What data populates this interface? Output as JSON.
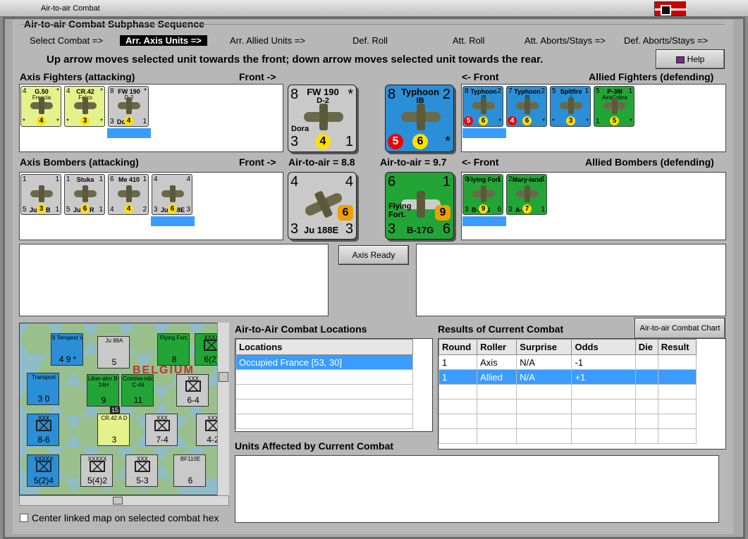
{
  "window": {
    "title": "Air-to-air Combat"
  },
  "sequence": {
    "title": "Air-to-air Combat Subphase Sequence",
    "steps": [
      "Select Combat =>",
      "Arr. Axis Units =>",
      "Arr. Allied Units =>",
      "Def. Roll",
      "Att. Roll",
      "Att. Aborts/Stays =>",
      "Def. Aborts/Stays =>"
    ],
    "active_index": 1
  },
  "instruction": "Up arrow moves selected unit towards the front; down arrow moves selected unit towards the rear.",
  "help_label": "Help",
  "axis_fighters": {
    "label": "Axis Fighters (attacking)",
    "front": "Front ->",
    "units": [
      {
        "tl": "4",
        "name": "G.50",
        "tr": "*",
        "sub": "Freccia",
        "bl": "*",
        "mid": "4",
        "br": "*",
        "color": "#e4f28c"
      },
      {
        "tl": "4",
        "name": "CR.42",
        "tr": "*",
        "sub": "Falco",
        "bl": "*",
        "mid": "3",
        "br": "*",
        "color": "#e4f28c"
      },
      {
        "tl": "8",
        "name": "FW 190",
        "tr": "*",
        "sub": "D-2",
        "sub2": "Dora",
        "bl": "3",
        "mid": "4",
        "br": "1",
        "color": "#c9c9c9"
      }
    ]
  },
  "axis_selected_fighter": {
    "tl": "8",
    "name": "FW 190",
    "sub": "D-2",
    "tr": "*",
    "sub2": "Dora",
    "bl": "3",
    "mid": "4",
    "br": "1"
  },
  "allied_selected_fighter": {
    "tl": "8",
    "name": "Typhoon",
    "sub": "IB",
    "tr": "2",
    "bl": "5",
    "mid": "6",
    "br": "*"
  },
  "allied_fighters": {
    "label": "Allied Fighters (defending)",
    "front": "<- Front",
    "units": [
      {
        "tl": "8",
        "name": "Typhoon",
        "sub": "IB",
        "tr": "2",
        "bl": "5",
        "mid": "6",
        "br": "*",
        "color": "#2a8fd6",
        "redbl": true
      },
      {
        "tl": "7",
        "name": "Typhoon",
        "sub": "IB",
        "tr": "2",
        "bl": "4",
        "mid": "6",
        "br": "*",
        "color": "#2a8fd6",
        "redbl": true
      },
      {
        "tl": "5",
        "name": "Spitfire",
        "sub": "I",
        "tr": "1",
        "bl": "*",
        "mid": "3",
        "br": "*",
        "color": "#2a8fd6"
      },
      {
        "tl": "5",
        "name": "P-39I",
        "sub": "AiraCobra",
        "tr": "1",
        "bl": "1",
        "mid": "5",
        "br": "*",
        "color": "#22a536"
      }
    ]
  },
  "axis_bombers": {
    "label": "Axis Bombers (attacking)",
    "front": "Front ->",
    "a2a": "Air-to-air = 8.8",
    "units": [
      {
        "tl": "1",
        "name": "",
        "tr": "1",
        "bl": "5",
        "mid": "3",
        "br": "1",
        "sub2": "Ju 87B",
        "color": "#c9c9c9"
      },
      {
        "tl": "1",
        "name": "Stuka",
        "tr": "1",
        "bl": "5",
        "mid": "6",
        "br": "1",
        "sub2": "Ju 87R",
        "color": "#c9c9c9"
      },
      {
        "tl": "6",
        "name": "Me 410",
        "tr": "1",
        "bl": "4",
        "mid": "4",
        "br": "2",
        "color": "#c9c9c9"
      },
      {
        "tl": "4",
        "name": "",
        "tr": "4",
        "bl": "3",
        "mid": "6",
        "br": "3",
        "sub2": "Ju 188E",
        "color": "#c9c9c9"
      }
    ]
  },
  "axis_selected_bomber": {
    "tl": "4",
    "tr": "4",
    "bl": "3",
    "name": "Ju 188E",
    "mid": "6",
    "br": "3"
  },
  "allied_selected_bomber": {
    "tl": "6",
    "tr": "1",
    "name": "B-17G",
    "sub": "Flying Fort.",
    "bl": "3",
    "mid": "9",
    "br": "6"
  },
  "allied_bombers": {
    "label": "Allied Bombers (defending)",
    "front": "<- Front",
    "a2a": "Air-to-air = 9.7",
    "units": [
      {
        "tl": "6",
        "name": "Flying Fort",
        "tr": "1",
        "bl": "3",
        "mid": "9",
        "br": "6",
        "sub2": "B-17G",
        "color": "#22a536"
      },
      {
        "tl": "2",
        "name": "Mary-land",
        "tr": "1",
        "bl": "3",
        "mid": "7",
        "br": "1",
        "sub2": "A-22",
        "color": "#22a536"
      }
    ]
  },
  "axis_ready_label": "Axis Ready",
  "locations": {
    "title": "Air-to-Air Combat Locations",
    "header": "Locations",
    "rows": [
      "Occupied France [53, 30]"
    ]
  },
  "results": {
    "title": "Results of Current Combat",
    "chart_button": "Air-to-air Combat Chart",
    "columns": [
      "Round",
      "Roller",
      "Surprise",
      "Odds",
      "Die",
      "Result"
    ],
    "rows": [
      [
        "1",
        "Axis",
        "N/A",
        "-1",
        "",
        ""
      ],
      [
        "1",
        "Allied",
        "N/A",
        "+1",
        "",
        ""
      ]
    ]
  },
  "units_affected": {
    "title": "Units Affected by Current Combat"
  },
  "map": {
    "counters": [
      {
        "t": "9 Tempest V",
        "v": "4 9 *",
        "c": "#2a8fd6"
      },
      {
        "t": "Ju 88A",
        "v": "5",
        "c": "#c9c9c9"
      },
      {
        "t": "Flying Fort.",
        "v": "8",
        "c": "#22a536"
      },
      {
        "t": "XXXX",
        "v": "6(2)",
        "c": "#22a536"
      },
      {
        "t": "Transport",
        "v": "3 0",
        "c": "#2a8fd6"
      },
      {
        "t": "Liber-ator B-24H",
        "v": "9",
        "c": "#22a536"
      },
      {
        "t": "Comma-ndo C-46",
        "v": "11",
        "c": "#22a536"
      },
      {
        "t": "XXX",
        "v": "6-4",
        "c": "#c9c9c9"
      },
      {
        "t": "XXX",
        "v": "8-6",
        "c": "#2a8fd6"
      },
      {
        "t": "CR.42 A D",
        "v": "3",
        "c": "#e4f28c"
      },
      {
        "t": "XXX",
        "v": "7-4",
        "c": "#c9c9c9"
      },
      {
        "t": "XXX",
        "v": "4-2",
        "c": "#c9c9c9"
      },
      {
        "t": "XXXXX",
        "v": "5(2)4",
        "c": "#2a8fd6"
      },
      {
        "t": "XXXXX",
        "v": "5(4)2",
        "c": "#c9c9c9"
      },
      {
        "t": "XXX",
        "v": "5-3",
        "c": "#c9c9c9"
      },
      {
        "t": "BF110E",
        "v": "6",
        "c": "#c9c9c9"
      }
    ],
    "labels": [
      "BELGIUM",
      "15"
    ]
  },
  "center_checkbox_label": "Center linked map on selected combat hex"
}
